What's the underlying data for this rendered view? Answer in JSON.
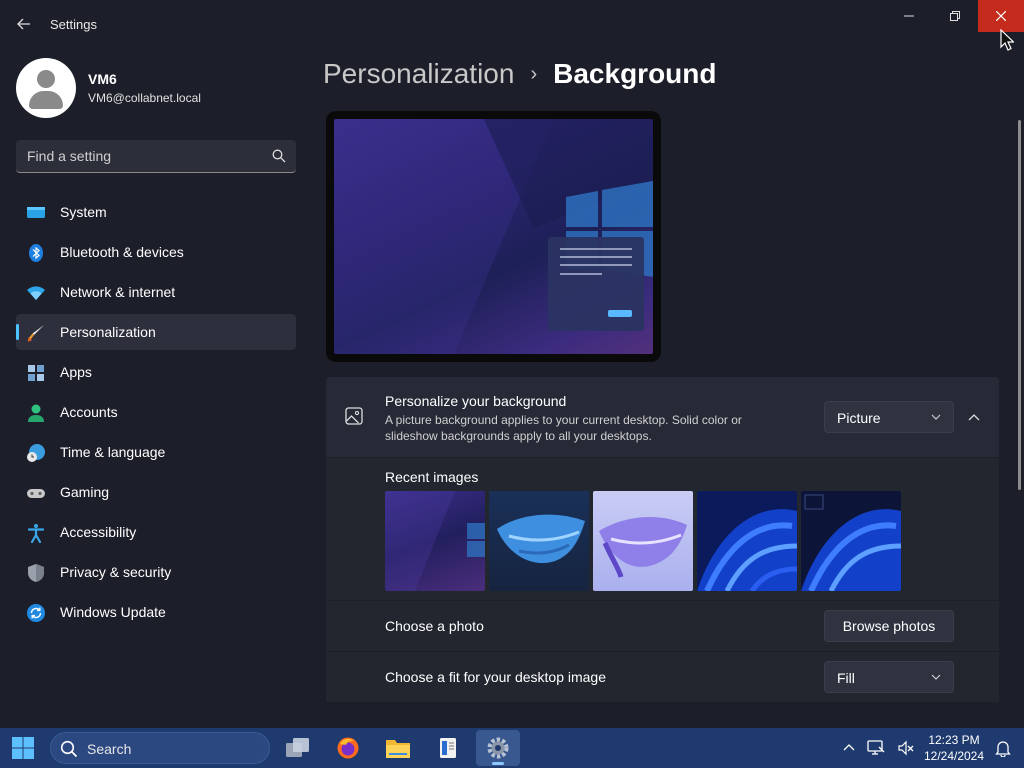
{
  "window": {
    "title": "Settings"
  },
  "profile": {
    "name": "VM6",
    "email": "VM6@collabnet.local"
  },
  "search": {
    "placeholder": "Find a setting"
  },
  "nav": {
    "items": [
      {
        "label": "System",
        "icon": "monitor-icon"
      },
      {
        "label": "Bluetooth & devices",
        "icon": "bluetooth-icon"
      },
      {
        "label": "Network & internet",
        "icon": "wifi-icon"
      },
      {
        "label": "Personalization",
        "icon": "brush-icon",
        "active": true
      },
      {
        "label": "Apps",
        "icon": "apps-icon"
      },
      {
        "label": "Accounts",
        "icon": "person-icon"
      },
      {
        "label": "Time & language",
        "icon": "globe-clock-icon"
      },
      {
        "label": "Gaming",
        "icon": "gamepad-icon"
      },
      {
        "label": "Accessibility",
        "icon": "accessibility-icon"
      },
      {
        "label": "Privacy & security",
        "icon": "shield-icon"
      },
      {
        "label": "Windows Update",
        "icon": "update-icon"
      }
    ]
  },
  "breadcrumb": {
    "parent": "Personalization",
    "separator": "›",
    "current": "Background"
  },
  "background": {
    "title": "Personalize your background",
    "description": "A picture background applies to your current desktop. Solid color or slideshow backgrounds apply to all your desktops.",
    "type_value": "Picture",
    "recent_label": "Recent images",
    "choose_photo_label": "Choose a photo",
    "browse_label": "Browse photos",
    "fit_label": "Choose a fit for your desktop image",
    "fit_value": "Fill"
  },
  "taskbar": {
    "search_label": "Search",
    "time": "12:23 PM",
    "date": "12/24/2024"
  },
  "colors": {
    "accent": "#4cc2ff",
    "close_red": "#c42b1c",
    "taskbar": "#1f3a6e"
  }
}
